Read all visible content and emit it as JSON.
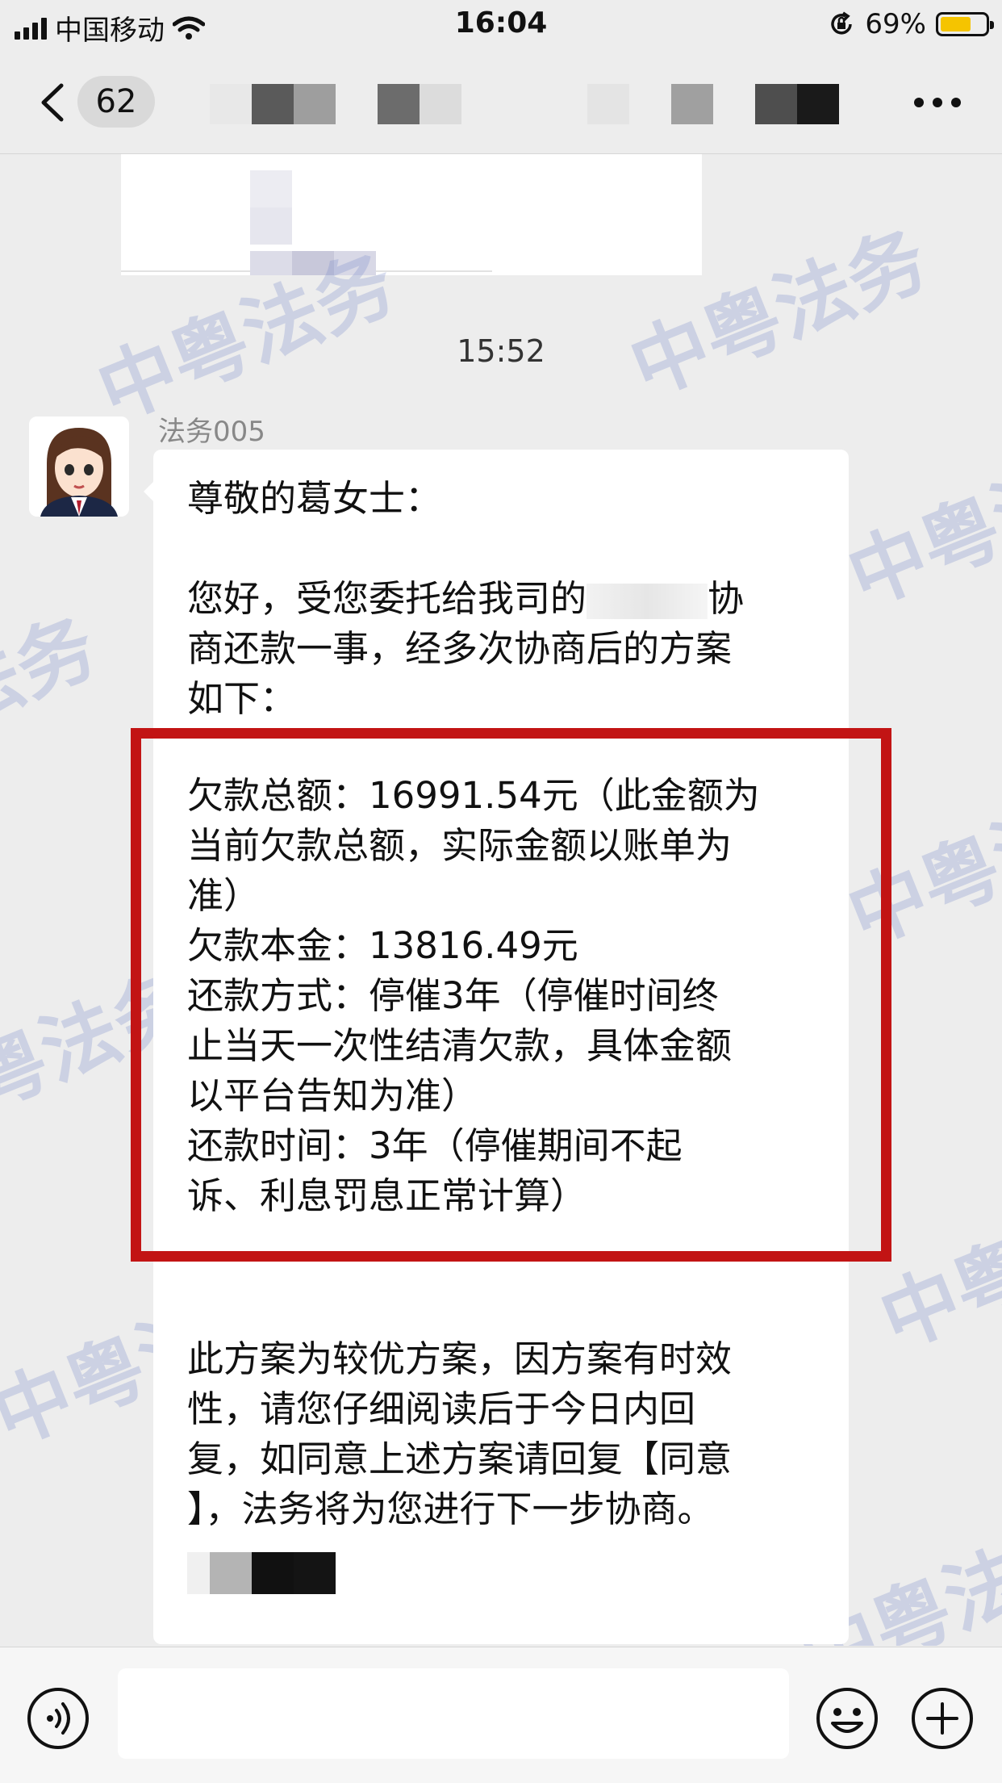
{
  "status_bar": {
    "carrier": "中国移动",
    "time": "16:04",
    "battery_percent": "69%",
    "battery_level": 0.69,
    "battery_color": "#f5c400"
  },
  "nav_bar": {
    "unread_count": "62",
    "title": "",
    "back_icon": "chevron-left-icon",
    "more_icon": "ellipsis-icon"
  },
  "chat": {
    "timestamp": "15:52",
    "watermark_text": "中粤法务",
    "message": {
      "sender": "法务005",
      "greeting": "尊敬的葛女士：",
      "intro_lines": [
        "您好，受您委托给我司的",
        "协",
        "商还款一事，经多次协商后的方案",
        "如下："
      ],
      "plan_lines": [
        "欠款总额：16991.54元（此金额为",
        "当前欠款总额，实际金额以账单为",
        "准）",
        "欠款本金：13816.49元",
        "还款方式：停催3年（停催时间终",
        "止当天一次性结清欠款，具体金额",
        "以平台告知为准）",
        "还款时间：3年（停催期间不起",
        "诉、利息罚息正常计算）"
      ],
      "closing_lines": [
        "此方案为较优方案，因方案有时效",
        "性，请您仔细阅读后于今日内回",
        "复，如同意上述方案请回复【同意",
        "】，法务将为您进行下一步协商。"
      ]
    },
    "highlight_color": "#c21414"
  },
  "input_bar": {
    "voice_icon": "voice-icon",
    "emoji_icon": "emoji-icon",
    "plus_icon": "plus-icon",
    "input_value": ""
  }
}
